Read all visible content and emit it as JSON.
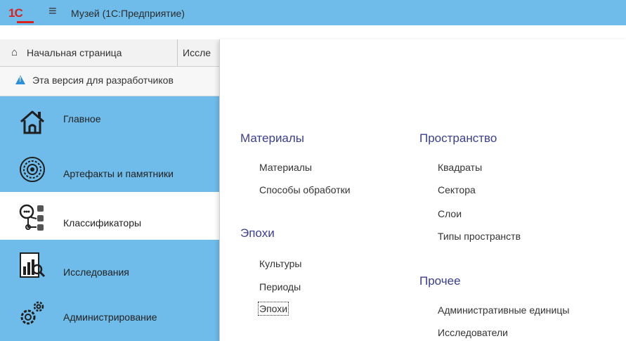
{
  "window": {
    "title": "Музей (1С:Предприятие)",
    "logo_text": "1С"
  },
  "icons": {
    "menu": "hamburger-menu-icon",
    "home": "home-icon",
    "warning": "warning-icon"
  },
  "tabs": [
    {
      "label": "Начальная страница"
    },
    {
      "label": "Иссле"
    }
  ],
  "info": {
    "text": "Эта версия для разработчиков"
  },
  "sidebar": {
    "items": [
      {
        "label": "Главное",
        "icon": "house-icon"
      },
      {
        "label": "Артефакты и памятники",
        "icon": "artifact-icon"
      },
      {
        "label": "Классификаторы",
        "icon": "classifier-icon",
        "active": true
      },
      {
        "label": "Исследования",
        "icon": "research-icon"
      },
      {
        "label": "Администрирование",
        "icon": "gears-icon"
      }
    ]
  },
  "panel": {
    "sections": [
      {
        "title": "Материалы",
        "items": [
          "Материалы",
          "Способы обработки"
        ]
      },
      {
        "title": "Эпохи",
        "items": [
          "Культуры",
          "Периоды",
          "Эпохи"
        ]
      },
      {
        "title": "Пространство",
        "items": [
          "Квадраты",
          "Сектора",
          "Слои",
          "Типы пространств"
        ]
      },
      {
        "title": "Прочее",
        "items": [
          "Административные единицы",
          "Исследователи"
        ]
      }
    ],
    "focused_item": "Эпохи"
  },
  "colors": {
    "accent": "#6fbcea",
    "heading": "#3a3f8f",
    "logo": "#d8231f"
  }
}
